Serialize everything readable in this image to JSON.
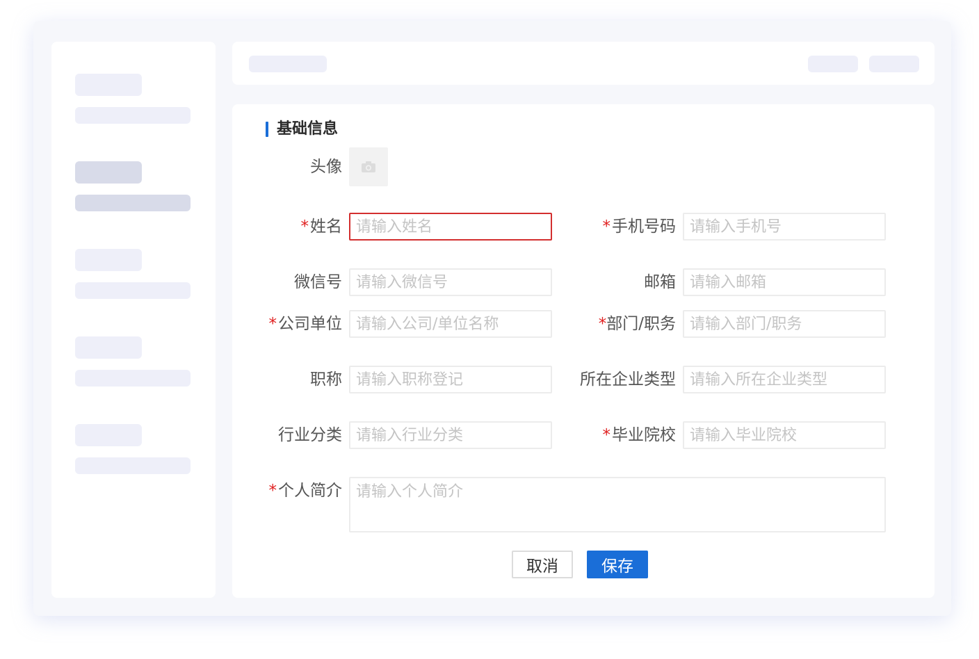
{
  "section": {
    "title": "基础信息"
  },
  "avatar": {
    "label": "头像",
    "icon": "camera-icon"
  },
  "fields": {
    "name": {
      "label": "姓名",
      "placeholder": "请输入姓名",
      "required": "*"
    },
    "phone": {
      "label": "手机号码",
      "placeholder": "请输入手机号",
      "required": "*"
    },
    "wechat": {
      "label": "微信号",
      "placeholder": "请输入微信号"
    },
    "email": {
      "label": "邮箱",
      "placeholder": "请输入邮箱"
    },
    "company": {
      "label": "公司单位",
      "placeholder": "请输入公司/单位名称",
      "required": "*"
    },
    "department": {
      "label": "部门/职务",
      "placeholder": "请输入部门/职务",
      "required": "*"
    },
    "title": {
      "label": "职称",
      "placeholder": "请输入职称登记"
    },
    "enterprise_type": {
      "label": "所在企业类型",
      "placeholder": "请输入所在企业类型"
    },
    "industry": {
      "label": "行业分类",
      "placeholder": "请输入行业分类"
    },
    "school": {
      "label": "毕业院校",
      "placeholder": "请输入毕业院校",
      "required": "*"
    },
    "bio": {
      "label": "个人简介",
      "placeholder": "请输入个人简介",
      "required": "*"
    }
  },
  "buttons": {
    "cancel": "取消",
    "save": "保存"
  },
  "colors": {
    "accent": "#1a6ed8",
    "error": "#d32f2f",
    "required": "#e02020"
  }
}
